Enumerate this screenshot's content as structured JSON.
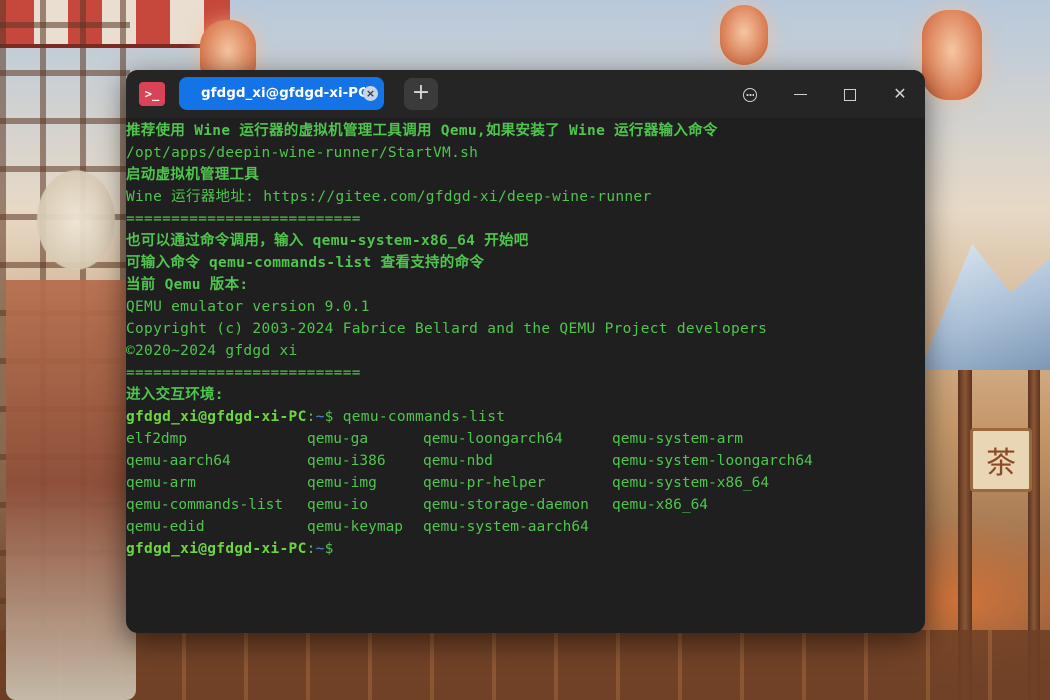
{
  "wallpaper": {
    "sign_text": "茶"
  },
  "window": {
    "app_icon": ">_",
    "tab_title": "gfdgd_xi@gfdgd-xi-PC: ~",
    "tab_close": "×",
    "add_tab": "+",
    "controls": {
      "close": "✕"
    }
  },
  "terminal": {
    "lines": [
      "推荐使用 Wine 运行器的虚拟机管理工具调用 Qemu,如果安装了 Wine 运行器输入命令",
      "/opt/apps/deepin-wine-runner/StartVM.sh",
      "启动虚拟机管理工具",
      "Wine 运行器地址: https://gitee.com/gfdgd-xi/deep-wine-runner",
      "==========================",
      "也可以通过命令调用，输入 qemu-system-x86_64 开始吧",
      "可输入命令 qemu-commands-list 查看支持的命令",
      "当前 Qemu 版本:",
      "QEMU emulator version 9.0.1",
      "Copyright (c) 2003-2024 Fabrice Bellard and the QEMU Project developers",
      "©2020~2024 gfdgd xi",
      "==========================",
      "进入交互环境:"
    ],
    "prompt": {
      "user": "gfdgd_xi@gfdgd-xi-PC",
      "sep": ":",
      "path": "~",
      "symbol": "$"
    },
    "command": " qemu-commands-list",
    "commands_grid": [
      [
        "elf2dmp",
        "qemu-ga",
        "qemu-loongarch64",
        "qemu-system-arm"
      ],
      [
        "qemu-aarch64",
        "qemu-i386",
        "qemu-nbd",
        "qemu-system-loongarch64"
      ],
      [
        "qemu-arm",
        "qemu-img",
        "qemu-pr-helper",
        "qemu-system-x86_64"
      ],
      [
        "qemu-commands-list",
        "qemu-io",
        "qemu-storage-daemon",
        "qemu-x86_64"
      ],
      [
        "qemu-edid",
        "qemu-keymap",
        "qemu-system-aarch64",
        ""
      ]
    ]
  },
  "colors": {
    "terminal_text": "#4fc54f",
    "prompt_user": "#6dd63f",
    "prompt_path": "#4b8bd9",
    "tab_active": "#1473e6",
    "app_icon": "#d94257"
  }
}
